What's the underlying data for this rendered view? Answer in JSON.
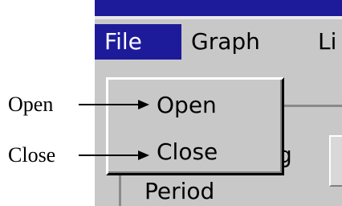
{
  "menubar": {
    "items": [
      {
        "label": "File"
      },
      {
        "label": "Graph"
      },
      {
        "label": "Li"
      }
    ]
  },
  "dropdown": {
    "items": [
      {
        "label": "Open"
      },
      {
        "label": "Close"
      }
    ]
  },
  "background": {
    "period_label": "Period",
    "partial_char": "g"
  },
  "annotations": {
    "open_label": "Open",
    "close_label": "Close"
  },
  "colors": {
    "titlebar": "#1e1b9a",
    "menu_highlight": "#1e1b9a",
    "window_bg": "#c8c8c8"
  }
}
